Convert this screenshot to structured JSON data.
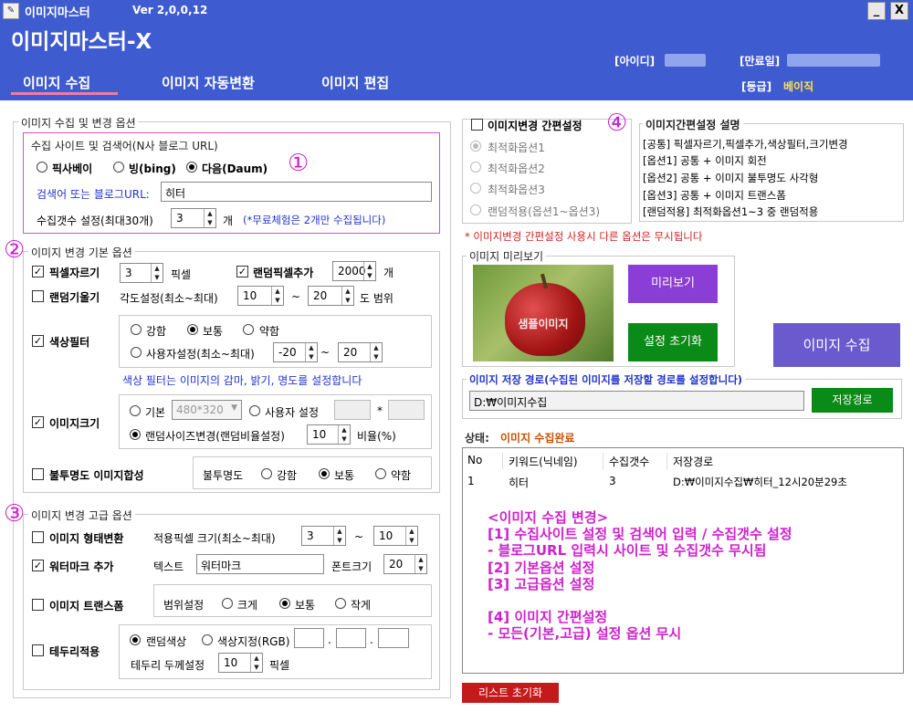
{
  "window": {
    "title": "이미지마스터",
    "version": "Ver 2,0,0,12",
    "minimize": "_",
    "close": "X"
  },
  "app": {
    "title": "이미지마스터-X"
  },
  "nav": {
    "tabs": [
      "이미지 수집",
      "이미지 자동변환",
      "이미지 편집"
    ]
  },
  "user": {
    "id_label": "[아이디]",
    "expire_label": "[만료일]",
    "grade_label": "[등급]",
    "grade_value": "베이직"
  },
  "collect": {
    "title": "이미지 수집 및 변경 옵션",
    "site_box_title": "수집 사이트 및 검색어(N사 블로그 URL)",
    "circle": "①",
    "sites": [
      "픽사베이",
      "빙(bing)",
      "다음(Daum)"
    ],
    "selected_site": "다음(Daum)",
    "keyword_label": "검색어 또는 블로그URL:",
    "keyword_value": "히터",
    "count_label": "수집갯수 설정(최대30개)",
    "count_value": "3",
    "count_unit": "개",
    "count_note": "(*무료체험은 2개만 수집됩니다)"
  },
  "basic": {
    "circle": "②",
    "title": "이미지 변경 기본 옵션",
    "pixel_crop": "픽셀자르기",
    "pixel_crop_value": "3",
    "pixel_unit": "픽셀",
    "random_pixel": "랜덤픽셀추가",
    "random_pixel_value": "2000",
    "random_pixel_unit": "개",
    "random_tilt": "랜덤기울기",
    "tilt_label": "각도설정(최소~최대)",
    "tilt_min": "10",
    "tilt_max": "20",
    "tilt_sep": "~",
    "tilt_unit": "도 범위",
    "color_filter": "색상필터",
    "filter_strong": "강함",
    "filter_normal": "보통",
    "filter_weak": "약함",
    "filter_custom": "사용자설정(최소~최대)",
    "filter_min": "-20",
    "filter_max": "20",
    "filter_note": "색상 필터는 이미지의 감마, 밝기, 명도를 설정합니다",
    "image_size": "이미지크기",
    "size_basic": "기본",
    "size_basic_value": "480*320",
    "size_user": "사용자 설정",
    "size_star": "*",
    "size_random": "랜덤사이즈변경(랜덤비율설정)",
    "size_ratio_value": "10",
    "size_ratio_unit": "비율(%)",
    "opacity": "불투명도 이미지합성",
    "opacity_label": "불투명도",
    "opacity_strong": "강함",
    "opacity_normal": "보통",
    "opacity_weak": "약함"
  },
  "advanced": {
    "circle": "③",
    "title": "이미지 변경 고급 옵션",
    "shape": "이미지 형태변환",
    "shape_label": "적용픽셀 크기(최소~최대)",
    "shape_min": "3",
    "shape_max": "10",
    "shape_sep": "~",
    "watermark": "워터마크 추가",
    "wm_text_label": "텍스트",
    "wm_text_value": "워터마크",
    "wm_font_label": "폰트크기",
    "wm_font_value": "20",
    "transform": "이미지 트랜스폼",
    "tr_label": "범위설정",
    "tr_large": "크게",
    "tr_normal": "보통",
    "tr_small": "작게",
    "border": "테두리적용",
    "border_random": "랜덤색상",
    "border_rgb": "색상지정(RGB)",
    "border_dot": ".",
    "border_width_label": "테두리 두께설정",
    "border_width_value": "10",
    "border_width_unit": "픽셀"
  },
  "simple": {
    "circle": "④",
    "title": "이미지변경 간편설정",
    "options": [
      "최적화옵션1",
      "최적화옵션2",
      "최적화옵션3",
      "랜덤적용(옵션1~옵션3)"
    ],
    "desc_title": "이미지간편설정 설명",
    "desc_lines": [
      "[공통] 픽셀자르기,픽셀추가,색상필터,크기변경",
      "[옵션1] 공통 + 이미지 회전",
      "[옵션2] 공통 + 이미지 불투명도 사각형",
      "[옵션3] 공통 + 이미지 트랜스폼",
      "[랜덤적용] 최적화옵션1~3 중 랜덤적용"
    ],
    "warning": "* 이미지변경 간편설정 사용시 다른 옵션은 무시됩니다"
  },
  "preview": {
    "title": "이미지 미리보기",
    "sample_label": "샘플이미지",
    "preview_button": "미리보기",
    "reset_button": "설정 초기화"
  },
  "collect_button": "이미지 수집",
  "save": {
    "title": "이미지 저장 경로(수집된 이미지를 저장할 경로를 설정합니다)",
    "path": "D:₩이미지수집",
    "button": "저장경로"
  },
  "status": {
    "label": "상태:",
    "value": "이미지 수집완료"
  },
  "table": {
    "headers": [
      "No",
      "키워드(닉네임)",
      "수집갯수",
      "저장경로"
    ],
    "rows": [
      [
        "1",
        "히터",
        "3",
        "D:₩이미지수집₩히터_12시20분29초"
      ]
    ]
  },
  "notes": {
    "lines": [
      "<이미지 수집 변경>",
      "[1] 수집사이트 설정 및 검색어 입력 / 수집갯수 설정",
      "- 블로그URL 입력시 사이트 및 수집갯수 무시됨",
      "[2] 기본옵션 설정",
      "[3] 고급옵션 설정",
      "",
      "[4] 이미지 간편설정",
      "- 모든(기본,고급) 설정 옵션 무시"
    ]
  },
  "list_reset_button": "리스트 초기화",
  "colors": {
    "header": "#3f5bd0",
    "purple_button": "#8b3ed6",
    "green_button": "#0a8a16",
    "collect_button": "#6a5acd",
    "red_button": "#c41a1a",
    "magenta": "#cc22cc"
  }
}
